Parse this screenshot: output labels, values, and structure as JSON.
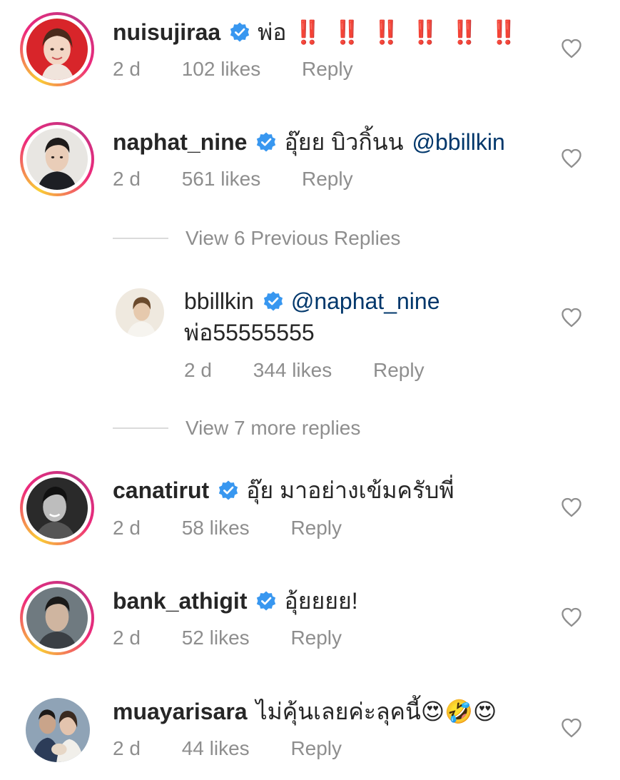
{
  "comments": [
    {
      "username": "nuisujiraa",
      "verified": true,
      "text": "พ่อ",
      "bangs": "‼️ ‼️ ‼️ ‼️ ‼️ ‼️",
      "time": "2 d",
      "likes": "102 likes",
      "reply": "Reply",
      "avatar_icon": "profile-photo"
    },
    {
      "username": "naphat_nine",
      "verified": true,
      "text": "อุ๊ยย บิวกิ้นน",
      "mention": "@bbillkin",
      "time": "2 d",
      "likes": "561 likes",
      "reply": "Reply",
      "avatar_icon": "profile-photo"
    },
    {
      "username": "canatirut",
      "verified": true,
      "text": "อุ๊ย มาอย่างเข้มครับพี่",
      "time": "2 d",
      "likes": "58 likes",
      "reply": "Reply",
      "avatar_icon": "profile-photo"
    },
    {
      "username": "bank_athigit",
      "verified": true,
      "text": "อุ้ยยยย!",
      "time": "2 d",
      "likes": "52 likes",
      "reply": "Reply",
      "avatar_icon": "profile-photo"
    },
    {
      "username": "muayarisara",
      "verified": false,
      "text": "ไม่คุ้นเลยค่ะลุคนี้",
      "emojis": "😍🤣😍",
      "time": "2 d",
      "likes": "44 likes",
      "reply": "Reply",
      "avatar_icon": "profile-photo"
    }
  ],
  "reply_thread": {
    "view_previous": "View 6 Previous Replies",
    "reply": {
      "username": "bbillkin",
      "verified": true,
      "mention": "@naphat_nine",
      "text": "พ่อ55555555",
      "time": "2 d",
      "likes": "344 likes",
      "reply": "Reply"
    },
    "view_more": "View 7 more replies"
  },
  "icons": {
    "like": "heart-outline-icon",
    "verified": "verified-badge-icon"
  },
  "colors": {
    "verified": "#3897f0",
    "mention": "#00376b",
    "secondary_text": "#8e8e8e",
    "primary_text": "#262626",
    "bang": "#e0202e"
  }
}
